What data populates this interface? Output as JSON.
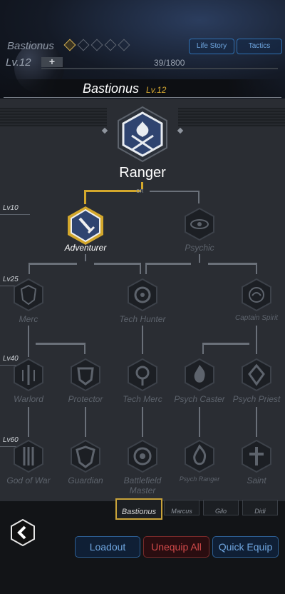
{
  "header": {
    "character_name": "Bastionus",
    "rank_filled": 1,
    "rank_total": 5,
    "level_label": "Lv.12",
    "plus_label": "+",
    "xp_text": "39/1800",
    "life_story_label": "Life Story",
    "tactics_label": "Tactics"
  },
  "title": {
    "name": "Bastionus",
    "level": "Lv.12"
  },
  "root": {
    "class_name": "Ranger",
    "or_label": "OR"
  },
  "level_tags": [
    "Lv10",
    "Lv25",
    "Lv40",
    "Lv60"
  ],
  "nodes": {
    "adventurer": "Adventurer",
    "psychic": "Psychic",
    "merc": "Merc",
    "tech_hunter": "Tech Hunter",
    "captain_spirit": "Captain Spirit",
    "warlord": "Warlord",
    "protector": "Protector",
    "tech_merc": "Tech Merc",
    "psych_caster": "Psych Caster",
    "psych_priest": "Psych Priest",
    "god_of_war": "God of War",
    "guardian": "Guardian",
    "battlefield_master": "Battlefield Master",
    "psych_ranger": "Psych Ranger",
    "saint": "Saint"
  },
  "party_tabs": [
    "Bastionus",
    "Marcus",
    "Gilo",
    "Didi"
  ],
  "footer": {
    "loadout_label": "Loadout",
    "unequip_all_label": "Unequip All",
    "quick_equip_label": "Quick Equip"
  },
  "colors": {
    "accent_gold": "#d3a72c",
    "accent_blue": "#6fa6e0",
    "accent_red": "#d24a4a",
    "locked_gray": "#5d636c"
  }
}
